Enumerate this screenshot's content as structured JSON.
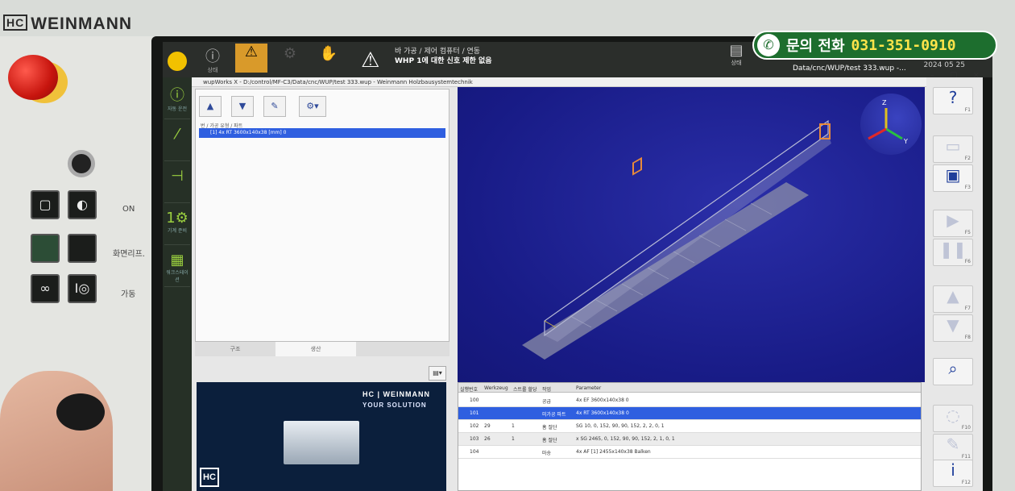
{
  "panel": {
    "brand_mark": "HC",
    "brand": "WEINMANN",
    "on_label": "ON",
    "label_2": "화면리프.",
    "label_3": "가동"
  },
  "topbar": {
    "tab_labels": [
      "상태",
      "",
      "",
      ""
    ],
    "warn_line1": "바 가공 / 제어 컴퓨터 / 연동",
    "warn_line2": "WHP 1에 대한 신호 제한 없음",
    "status_label": "상태",
    "path": "Data/cnc/WUP/test 333.wup -...",
    "timestamp": "2024 05 25"
  },
  "phone_banner": {
    "label": "문의 전화",
    "number": "031-351-0910"
  },
  "leftnav": {
    "items": [
      "자동 운전",
      "",
      "",
      "기계 준비",
      "워크스테이션"
    ]
  },
  "window": {
    "title": "wupWorks X - D:/control/MF-C3/Data/cnc/WUP/test 333.wup - Weinmann Holzbausystemtechnik"
  },
  "tree": {
    "header": "번 / 가공 유형 / 파트",
    "selected_item": "[1] 4x RT 3600x140x38 [mm] 0",
    "tabs": [
      "구조",
      "생산"
    ]
  },
  "ad": {
    "logo": "HC | WEINMANN",
    "slogan": "YOUR SOLUTION",
    "mark": "HC"
  },
  "ops_table": {
    "headers": [
      "실행번호",
      "Werkzeug",
      "스트롤 할당",
      "작업",
      "Parameter"
    ],
    "rows": [
      {
        "nr": "100",
        "tool": "",
        "strip": "",
        "op": "공급",
        "param": "4x EF 3600x140x38 0",
        "state": "normal"
      },
      {
        "nr": "101",
        "tool": "",
        "strip": "",
        "op": "미가공 파트",
        "param": "4x RT 3600x140x38 0",
        "state": "selected"
      },
      {
        "nr": "102",
        "tool": "29",
        "strip": "1",
        "op": "홈 절단",
        "param": "SG 10, 0, 152, 90, 90, 152, 2, 2, 0, 1",
        "state": "normal"
      },
      {
        "nr": "103",
        "tool": "26",
        "strip": "1",
        "op": "홈 절단",
        "param": "x SG 2465, 0, 152, 90, 90, 152, 2, 1, 0, 1",
        "state": "alt"
      },
      {
        "nr": "104",
        "tool": "",
        "strip": "",
        "op": "마송",
        "param": "4x AF [1] 2455x140x38 Balken",
        "state": "normal"
      }
    ]
  },
  "rightbar": {
    "buttons": [
      {
        "name": "help-button",
        "glyph": "?",
        "key": "F1",
        "dim": false
      },
      {
        "name": "open-folder-button",
        "glyph": "▭",
        "key": "F2",
        "dim": true
      },
      {
        "name": "save-button",
        "glyph": "▣",
        "key": "F3",
        "dim": false
      },
      {
        "name": "play-button",
        "glyph": "▶",
        "key": "F5",
        "dim": true
      },
      {
        "name": "pause-button",
        "glyph": "❚❚",
        "key": "F6",
        "dim": true
      },
      {
        "name": "arrow-up-button",
        "glyph": "▲",
        "key": "F7",
        "dim": true
      },
      {
        "name": "arrow-down-button",
        "glyph": "▼",
        "key": "F8",
        "dim": true
      },
      {
        "name": "zoom-button",
        "glyph": "⌕",
        "key": "",
        "dim": false
      },
      {
        "name": "reset-view-button",
        "glyph": "◌",
        "key": "F10",
        "dim": true
      },
      {
        "name": "wrench-button",
        "glyph": "✎",
        "key": "F11",
        "dim": true
      },
      {
        "name": "info-button",
        "glyph": "i",
        "key": "F12",
        "dim": false
      }
    ]
  },
  "colors": {
    "accent_blue": "#2f5fe0",
    "viewport_blue": "#1c1f8e",
    "warning_orange": "#d99a2a",
    "phone_green": "#1d6e2e",
    "phone_yellow": "#ffe44a"
  }
}
